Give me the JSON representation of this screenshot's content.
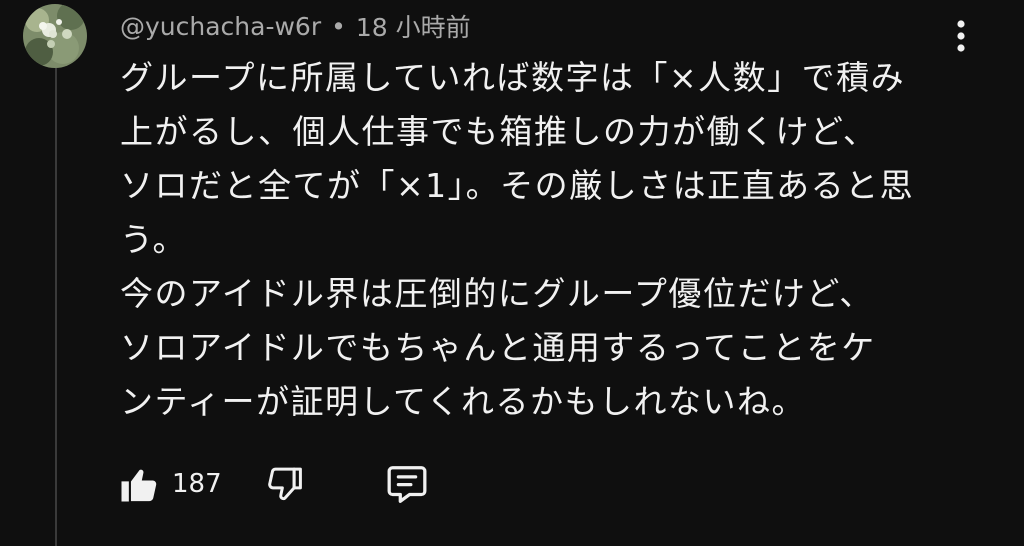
{
  "comment": {
    "author": "@yuchacha-w6r",
    "separator": "•",
    "timestamp": "18 小時前",
    "lines": [
      "グループに所属していれば数字は「×人数」で積み",
      "上がるし、個人仕事でも箱推しの力が働くけど、",
      "ソロだと全てが「×1」。その厳しさは正直あると思",
      "う。",
      "今のアイドル界は圧倒的にグループ優位だけど、",
      "ソロアイドルでもちゃんと通用するってことをケ",
      "ンティーが証明してくれるかもしれないね。"
    ]
  },
  "actions": {
    "like_count": "187",
    "like_icon": "thumbs-up-icon",
    "dislike_icon": "thumbs-down-icon",
    "reply_icon": "reply-comment-icon",
    "more_icon": "more-vertical-icon"
  },
  "colors": {
    "background": "#0f0f0f",
    "text": "#f1f1f1",
    "meta": "#aaaaaa",
    "thread_line": "#3a3a3a"
  }
}
